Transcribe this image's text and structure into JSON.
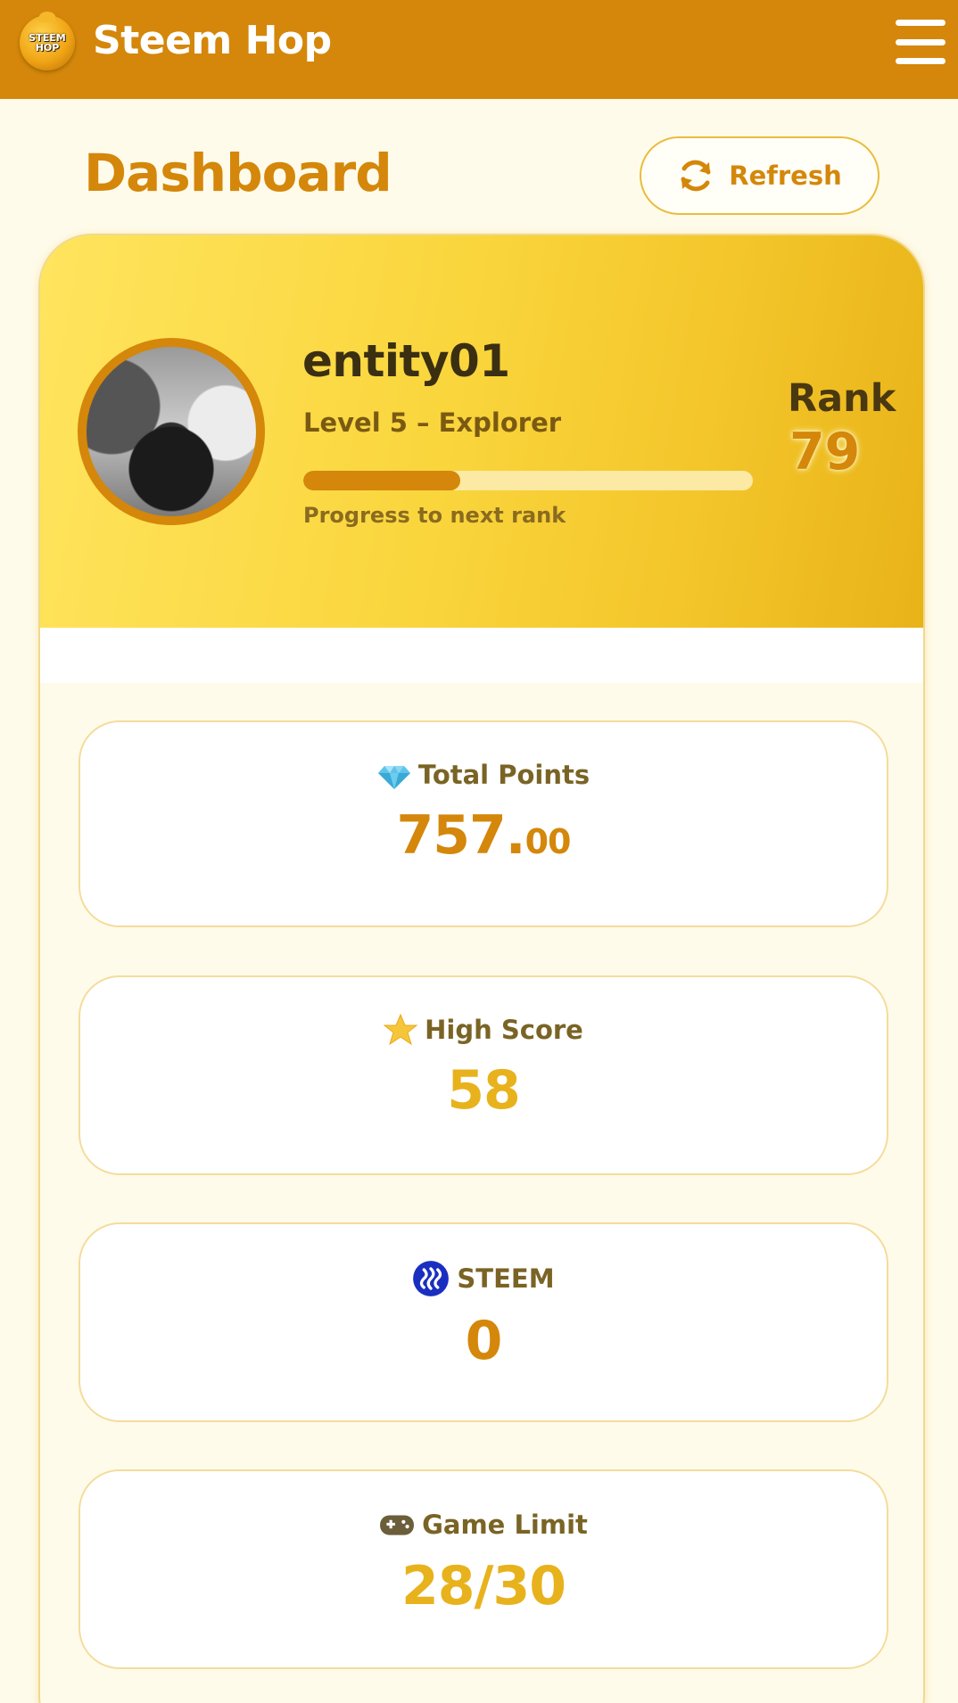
{
  "header": {
    "logo_text_line1": "STEEM",
    "logo_text_line2": "HOP",
    "app_title": "Steem Hop",
    "menu_icon": "hamburger-menu-icon"
  },
  "page": {
    "title": "Dashboard",
    "refresh_label": "Refresh",
    "refresh_icon": "sync-arrows-icon"
  },
  "profile": {
    "username": "entity01",
    "level": "Level 5 – Explorer",
    "progress_label": "Progress to next rank",
    "progress_fraction": 0.35,
    "rank_label": "Rank",
    "rank_value": "79"
  },
  "stats": [
    {
      "label": "Total Points",
      "icon": "gem-icon",
      "value_int": "757.",
      "value_dec": "00",
      "color": "#d4870a"
    },
    {
      "label": "High Score",
      "icon": "star-icon",
      "value": "58",
      "color": "#e8b21d"
    },
    {
      "label": "STEEM",
      "icon": "steem-logo-icon",
      "value": "0",
      "color": "#d4870a"
    },
    {
      "label": "Game Limit",
      "icon": "gamepad-icon",
      "value": "28/30",
      "color": "#e8b21d"
    }
  ],
  "colors": {
    "brand": "#d4870a",
    "accent_yellow": "#e8b21d",
    "background": "#fffbea"
  }
}
